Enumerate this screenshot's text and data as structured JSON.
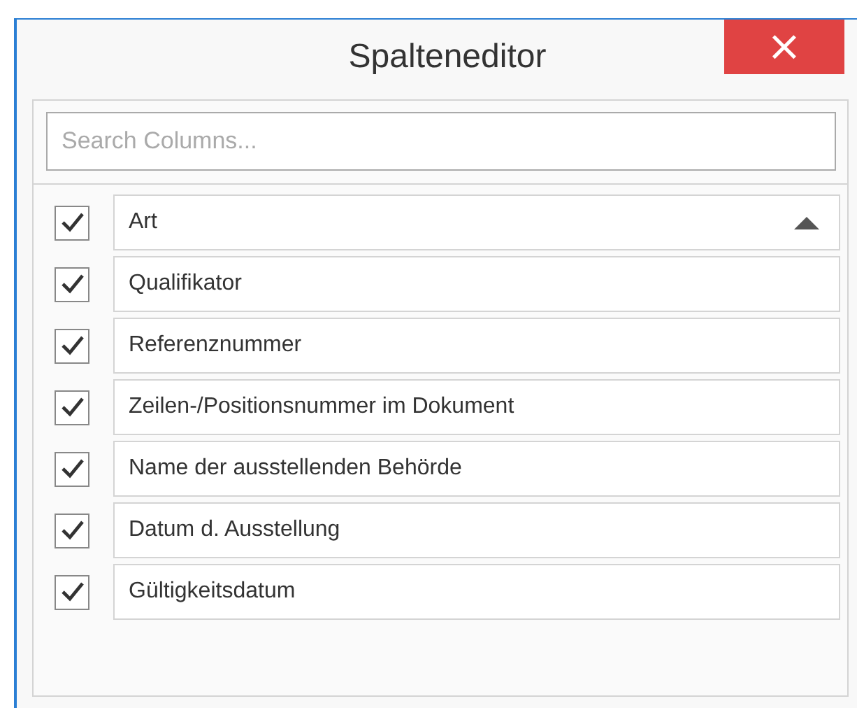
{
  "window": {
    "title": "Spalteneditor",
    "close": "×"
  },
  "search": {
    "placeholder": "Search Columns..."
  },
  "columns": [
    {
      "label": "Art",
      "checked": true,
      "sorted": true
    },
    {
      "label": "Qualifikator",
      "checked": true,
      "sorted": false
    },
    {
      "label": "Referenznummer",
      "checked": true,
      "sorted": false
    },
    {
      "label": "Zeilen-/Positionsnummer im Dokument",
      "checked": true,
      "sorted": false
    },
    {
      "label": "Name der ausstellenden Behörde",
      "checked": true,
      "sorted": false
    },
    {
      "label": "Datum d. Ausstellung",
      "checked": true,
      "sorted": false
    },
    {
      "label": "Gültigkeitsdatum",
      "checked": true,
      "sorted": false
    }
  ]
}
